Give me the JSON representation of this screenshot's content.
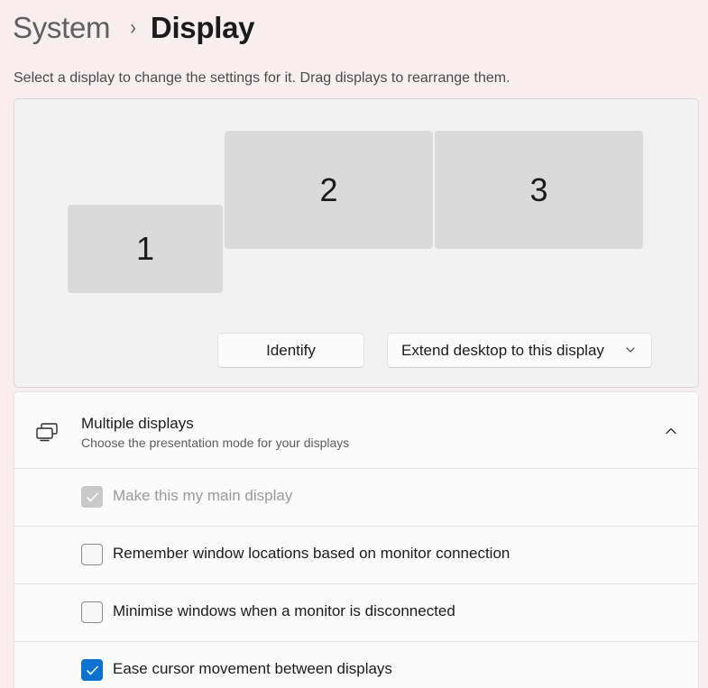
{
  "breadcrumb": {
    "parent": "System",
    "separator": "›",
    "current": "Display"
  },
  "instructions": "Select a display to change the settings for it. Drag displays to rearrange them.",
  "displays": [
    {
      "number": "1",
      "selected": false
    },
    {
      "number": "2",
      "selected": true
    },
    {
      "number": "3",
      "selected": false
    }
  ],
  "actions": {
    "identify_label": "Identify",
    "mode_select_value": "Extend desktop to this display"
  },
  "multiple_displays": {
    "title": "Multiple displays",
    "description": "Choose the presentation mode for your displays",
    "expanded": true,
    "options": [
      {
        "label": "Make this my main display",
        "checked": true,
        "disabled": true
      },
      {
        "label": "Remember window locations based on monitor connection",
        "checked": false,
        "disabled": false
      },
      {
        "label": "Minimise windows when a monitor is disconnected",
        "checked": false,
        "disabled": false
      },
      {
        "label": "Ease cursor movement between displays",
        "checked": true,
        "disabled": false
      }
    ]
  },
  "colors": {
    "accent": "#0a72d1",
    "background": "#f6eeef",
    "panel": "#f2f2f2",
    "card": "#fbfbfb",
    "monitor_unselected": "#dadada",
    "checkbox_disabled": "#c9c9c9"
  },
  "icons": {
    "breadcrumb_separator": "chevron-right-icon",
    "mode_dropdown": "chevron-down-icon",
    "section": "multiple-displays-icon",
    "section_toggle": "chevron-up-icon",
    "checkmark": "checkmark-icon"
  }
}
